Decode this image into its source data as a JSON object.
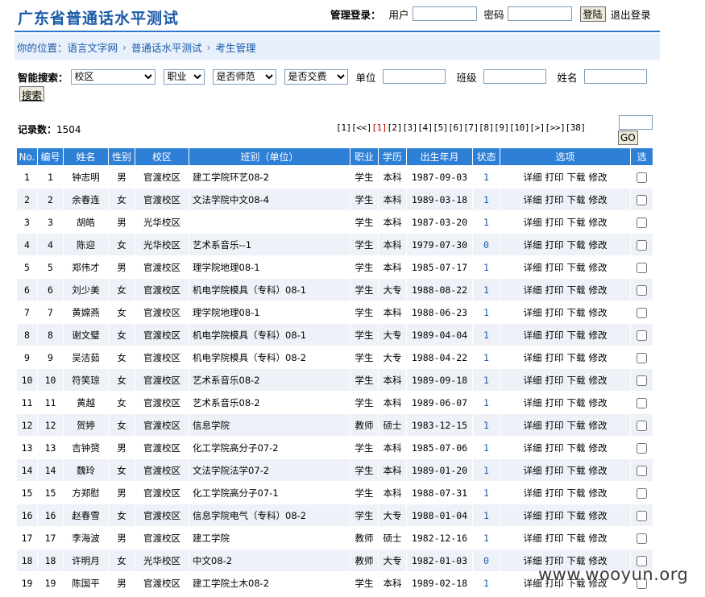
{
  "header": {
    "site_title": "广东省普通话水平测试",
    "login": {
      "label": "管理登录：",
      "user_label": "用户",
      "password_label": "密码",
      "login_button": "登陆",
      "logout_link": "退出登录"
    }
  },
  "breadcrumb": {
    "prefix": "你的位置：",
    "items": [
      "语言文字网",
      "普通话水平测试",
      "考生管理"
    ],
    "separator": "›"
  },
  "search": {
    "label": "智能搜索：",
    "selects": [
      "校区",
      "职业",
      "是否师范",
      "是否交费"
    ],
    "fields": [
      "单位",
      "班级",
      "姓名"
    ],
    "button": "搜索"
  },
  "records": {
    "label": "记录数：",
    "count": "1504"
  },
  "pager": {
    "items": [
      "[1]",
      "[<<]",
      "[1]",
      "[2]",
      "[3]",
      "[4]",
      "[5]",
      "[6]",
      "[7]",
      "[8]",
      "[9]",
      "[10]",
      "[>]",
      "[>>]",
      "[38]"
    ],
    "current_index": 2,
    "go_button": "GO"
  },
  "table": {
    "headers": [
      "No.",
      "编号",
      "姓名",
      "性别",
      "校区",
      "班别（单位）",
      "职业",
      "学历",
      "出生年月",
      "状态",
      "选项",
      "选"
    ],
    "actions": [
      "详细",
      "打印",
      "下载",
      "修改"
    ],
    "rows": [
      [
        "1",
        "1",
        "钟志明",
        "男",
        "官渡校区",
        "建工学院环艺08-2",
        "学生",
        "本科",
        "1987-09-03",
        "1"
      ],
      [
        "2",
        "2",
        "余春连",
        "女",
        "官渡校区",
        "文法学院中文08-4",
        "学生",
        "本科",
        "1989-03-18",
        "1"
      ],
      [
        "3",
        "3",
        "胡皓",
        "男",
        "光华校区",
        "",
        "学生",
        "本科",
        "1987-03-20",
        "1"
      ],
      [
        "4",
        "4",
        "陈迎",
        "女",
        "光华校区",
        "艺术系音乐--1",
        "学生",
        "本科",
        "1979-07-30",
        "0"
      ],
      [
        "5",
        "5",
        "郑伟才",
        "男",
        "官渡校区",
        "理学院地理08-1",
        "学生",
        "本科",
        "1985-07-17",
        "1"
      ],
      [
        "6",
        "6",
        "刘少美",
        "女",
        "官渡校区",
        "机电学院模具（专科）08-1",
        "学生",
        "大专",
        "1988-08-22",
        "1"
      ],
      [
        "7",
        "7",
        "黄嫦燕",
        "女",
        "官渡校区",
        "理学院地理08-1",
        "学生",
        "本科",
        "1988-06-23",
        "1"
      ],
      [
        "8",
        "8",
        "谢文璧",
        "女",
        "官渡校区",
        "机电学院模具（专科）08-1",
        "学生",
        "大专",
        "1989-04-04",
        "1"
      ],
      [
        "9",
        "9",
        "吴洁茹",
        "女",
        "官渡校区",
        "机电学院模具（专科）08-2",
        "学生",
        "大专",
        "1988-04-22",
        "1"
      ],
      [
        "10",
        "10",
        "符笑琼",
        "女",
        "官渡校区",
        "艺术系音乐08-2",
        "学生",
        "本科",
        "1989-09-18",
        "1"
      ],
      [
        "11",
        "11",
        "黄越",
        "女",
        "官渡校区",
        "艺术系音乐08-2",
        "学生",
        "本科",
        "1989-06-07",
        "1"
      ],
      [
        "12",
        "12",
        "贺婷",
        "女",
        "官渡校区",
        "信息学院",
        "教师",
        "硕士",
        "1983-12-15",
        "1"
      ],
      [
        "13",
        "13",
        "吉钟赟",
        "男",
        "官渡校区",
        "化工学院高分子07-2",
        "学生",
        "本科",
        "1985-07-06",
        "1"
      ],
      [
        "14",
        "14",
        "魏玲",
        "女",
        "官渡校区",
        "文法学院法学07-2",
        "学生",
        "本科",
        "1989-01-20",
        "1"
      ],
      [
        "15",
        "15",
        "方郑慰",
        "男",
        "官渡校区",
        "化工学院高分子07-1",
        "学生",
        "本科",
        "1988-07-31",
        "1"
      ],
      [
        "16",
        "16",
        "赵春雪",
        "女",
        "官渡校区",
        "信息学院电气（专科）08-2",
        "学生",
        "大专",
        "1988-01-04",
        "1"
      ],
      [
        "17",
        "17",
        "李海波",
        "男",
        "官渡校区",
        "建工学院",
        "教师",
        "硕士",
        "1982-12-16",
        "1"
      ],
      [
        "18",
        "18",
        "许明月",
        "女",
        "光华校区",
        "中文08-2",
        "教师",
        "大专",
        "1982-01-03",
        "0"
      ],
      [
        "19",
        "19",
        "陈国平",
        "男",
        "官渡校区",
        "建工学院土木08-2",
        "学生",
        "本科",
        "1989-02-18",
        "1"
      ]
    ]
  },
  "watermark": "www.wooyun.org"
}
